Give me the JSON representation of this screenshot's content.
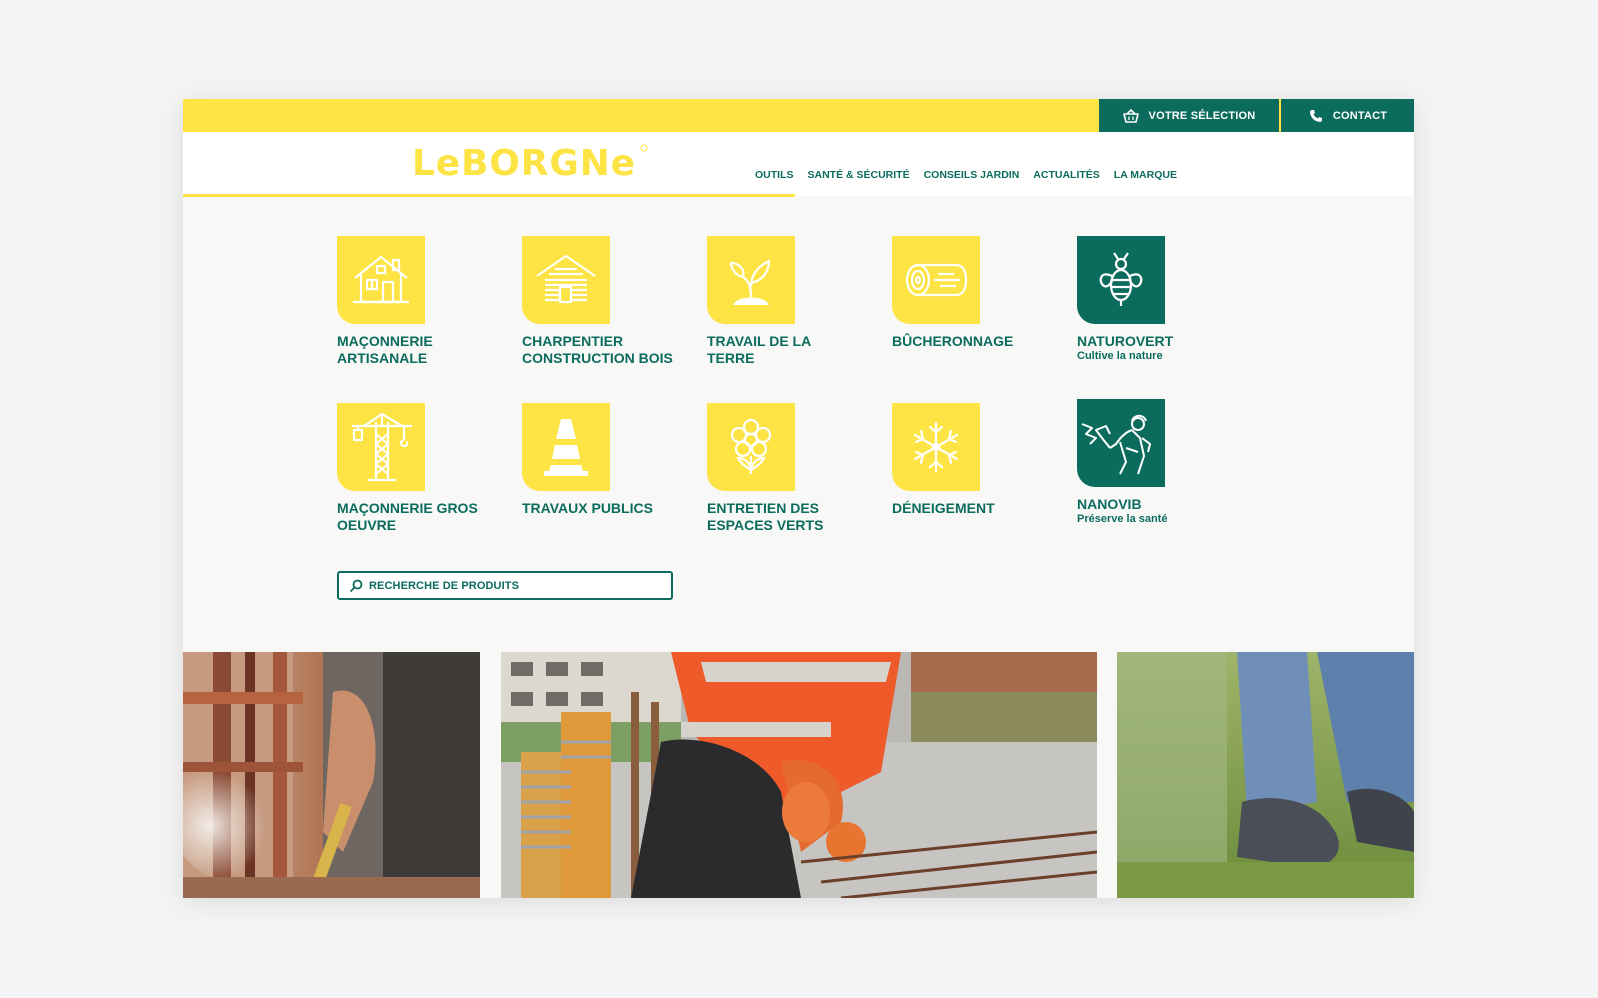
{
  "topbar": {
    "selection_label": "VOTRE SÉLECTION",
    "contact_label": "CONTACT"
  },
  "header": {
    "logo_text": "LeBORGNe",
    "nav": [
      "OUTILS",
      "SANTÉ & SÉCURITÉ",
      "CONSEILS JARDIN",
      "ACTUALITÉS",
      "LA MARQUE"
    ]
  },
  "categories": [
    {
      "label": "MAÇONNERIE\nARTISANALE",
      "icon": "house-icon"
    },
    {
      "label": "CHARPENTIER\nCONSTRUCTION BOIS",
      "icon": "log-cabin-icon"
    },
    {
      "label": "TRAVAIL DE LA\nTERRE",
      "icon": "sprout-icon"
    },
    {
      "label": "BÛCHERONNAGE",
      "icon": "log-icon"
    },
    {
      "label": "NATUROVERT",
      "sub": "Cultive la nature",
      "icon": "bee-icon"
    },
    {
      "label": "MAÇONNERIE GROS\nOEUVRE",
      "icon": "crane-icon"
    },
    {
      "label": "TRAVAUX PUBLICS",
      "icon": "traffic-cone-icon"
    },
    {
      "label": "ENTRETIEN DES\nESPACES VERTS",
      "icon": "flower-icon"
    },
    {
      "label": "DÉNEIGEMENT",
      "icon": "snowflake-icon"
    },
    {
      "label": "NANOVIB",
      "sub": "Préserve la santé",
      "icon": "worker-icon"
    }
  ],
  "search": {
    "placeholder": "RECHERCHE DE PRODUITS"
  },
  "colors": {
    "yellow": "#fde344",
    "green": "#0b6c5e"
  }
}
